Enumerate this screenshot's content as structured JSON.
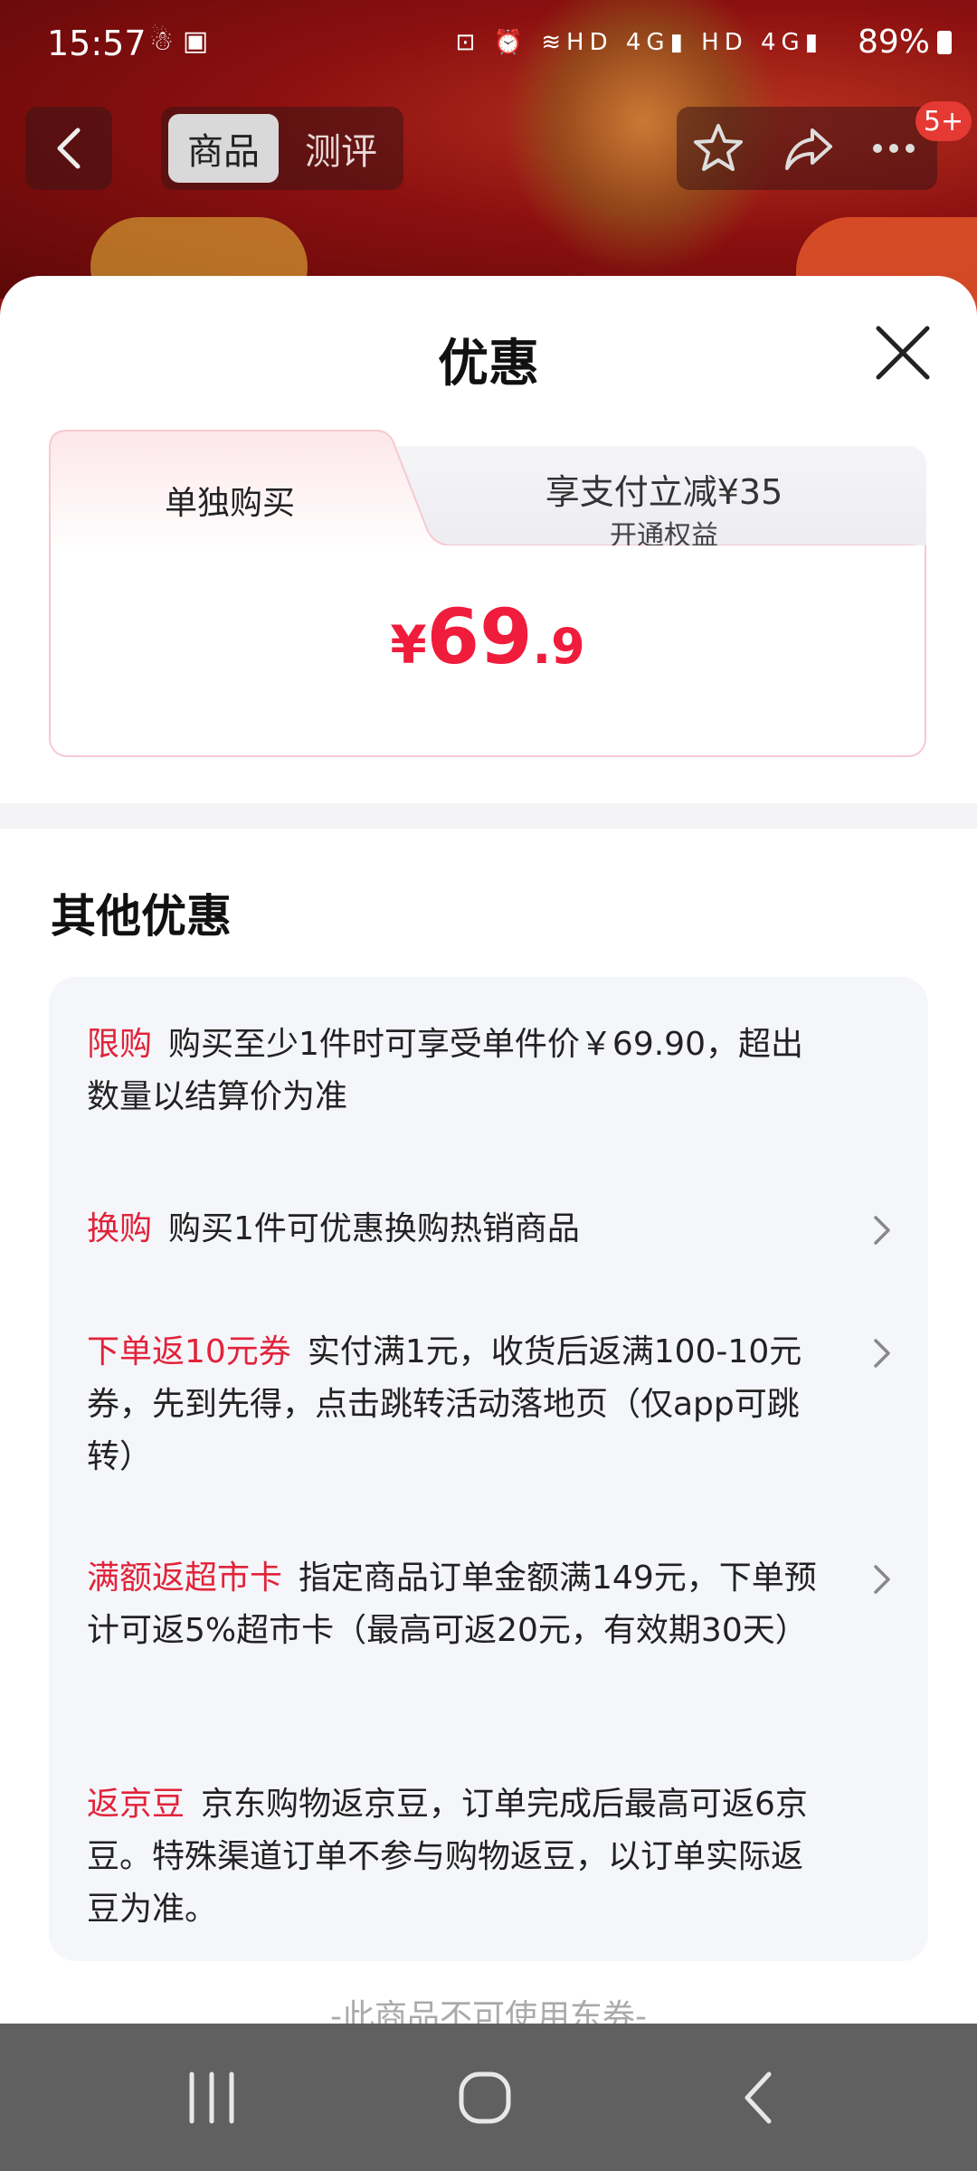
{
  "status_bar": {
    "time": "15:57",
    "signal_labels": [
      "HD",
      "4G",
      "HD",
      "4G"
    ],
    "battery": "89%"
  },
  "top_nav": {
    "tabs": [
      {
        "label": "商品",
        "active": true
      },
      {
        "label": "测评",
        "active": false
      }
    ],
    "badge": "5+"
  },
  "sheet": {
    "title": "优惠",
    "purchase_tabs": {
      "left_label": "单独购买",
      "right_label": "享支付立减¥35",
      "right_sublabel": "开通权益"
    },
    "price": {
      "currency": "¥",
      "integer": "69",
      "decimal": ".9"
    },
    "section_title": "其他优惠",
    "offers": [
      {
        "tag": "限购",
        "text": "购买至少1件时可享受单件价￥69.90，超出数量以结算价为准",
        "has_arrow": false
      },
      {
        "tag": "换购",
        "text": "购买1件可优惠换购热销商品",
        "has_arrow": true
      },
      {
        "tag": "下单返10元券",
        "text": "实付满1元，收货后返满100-10元券，先到先得，点击跳转活动落地页（仅app可跳转）",
        "has_arrow": true
      },
      {
        "tag": "满额返超市卡",
        "text": "指定商品订单金额满149元，下单预计可返5%超市卡（最高可返20元，有效期30天）",
        "has_arrow": true
      },
      {
        "tag": "返京豆",
        "text": "京东购物返京豆，订单完成后最高可返6京豆。特殊渠道订单不参与购物返豆，以订单实际返豆为准。",
        "has_arrow": false
      }
    ],
    "footer_note": "-此商品不可使用东券-"
  },
  "colors": {
    "accent_red": "#f01c3c",
    "tag_red": "#e2233a",
    "offers_bg": "#f5f6fa",
    "system_nav_bg": "#606060"
  }
}
